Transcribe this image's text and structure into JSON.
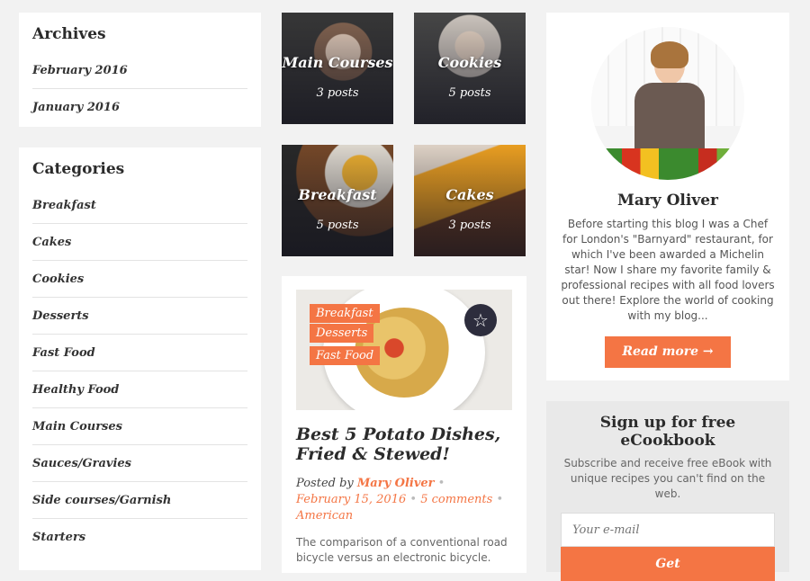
{
  "archives": {
    "title": "Archives",
    "items": [
      {
        "label": "February 2016"
      },
      {
        "label": "January 2016"
      }
    ]
  },
  "categories": {
    "title": "Categories",
    "items": [
      {
        "label": "Breakfast"
      },
      {
        "label": "Cakes"
      },
      {
        "label": "Cookies"
      },
      {
        "label": "Desserts"
      },
      {
        "label": "Fast Food"
      },
      {
        "label": "Healthy Food"
      },
      {
        "label": "Main Courses"
      },
      {
        "label": "Sauces/Gravies"
      },
      {
        "label": "Side courses/Garnish"
      },
      {
        "label": "Starters"
      }
    ]
  },
  "tiles": [
    {
      "name": "Main Courses",
      "count": "3 posts"
    },
    {
      "name": "Cookies",
      "count": "5 posts"
    },
    {
      "name": "Breakfast",
      "count": "5 posts"
    },
    {
      "name": "Cakes",
      "count": "3 posts"
    }
  ],
  "post": {
    "tags": [
      "Breakfast",
      "Desserts",
      "Fast Food"
    ],
    "title": "Best 5 Potato Dishes, Fried & Stewed!",
    "posted_by": "Posted by",
    "author": "Mary Oliver",
    "date": "February 15, 2016",
    "comments": "5 comments",
    "cuisine": "American",
    "excerpt": "The comparison of a conventional road bicycle versus an electronic bicycle."
  },
  "author_box": {
    "name": "Mary Oliver",
    "bio": "Before starting this blog I was a Chef for London's \"Barnyard\" restaurant, for which I've been awarded a Michelin star! Now I share my favorite family & professional recipes with all food lovers out there! Explore the world of cooking with my blog...",
    "read_more": "Read more"
  },
  "newsletter": {
    "title": "Sign up for free eCookbook",
    "subtitle": "Subscribe and receive free eBook with unique recipes you can't find on the web.",
    "placeholder": "Your e-mail",
    "button": "Get"
  },
  "colors": {
    "accent": "#f47544",
    "background": "#f2f2f2",
    "star_badge": "#2d2d3d"
  }
}
